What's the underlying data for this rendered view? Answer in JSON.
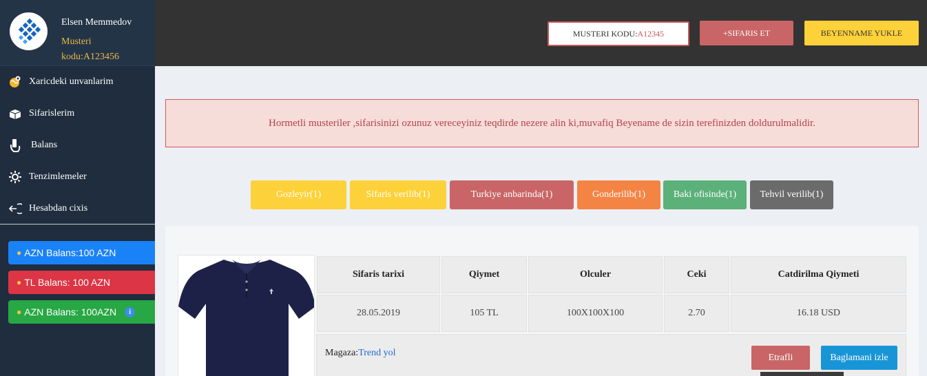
{
  "profile": {
    "name": "Elsen Memmedov",
    "role": "Musteri kodu:A123456"
  },
  "menu": [
    {
      "label": "Xaricdeki unvanlarim",
      "icon": "globe-pin-icon"
    },
    {
      "label": "Sifarislerim",
      "icon": "box-icon"
    },
    {
      "label": "Balans",
      "icon": "hand-money-icon"
    },
    {
      "label": "Tenzimlemeler",
      "icon": "settings-icon"
    },
    {
      "label": "Hesabdan cixis",
      "icon": "logout-icon"
    }
  ],
  "balances": [
    {
      "label": "AZN Balans:100 AZN",
      "color": "#1a82f7"
    },
    {
      "label": "TL Balans: 100 AZN",
      "color": "#dc3545"
    },
    {
      "label": "AZN Balans: 100AZN",
      "color": "#28a745",
      "info": "i"
    }
  ],
  "topbar": {
    "code_label": "MUSTERI KODU:",
    "code_value": "A12345",
    "order_button": "+SIFARIS ET",
    "declaration_button": "BEYENNAME YUKLE"
  },
  "alert": "Hormetli musteriler ,sifarisinizi ozunuz vereceyiniz teqdirde nezere alin ki,muvafiq Beyename de sizin terefinizden doldurulmalidir.",
  "statuses": [
    {
      "label": "Gozleyir(1)",
      "color": "#fcd139"
    },
    {
      "label": "Sifaris verilib(1)",
      "color": "#fcd139"
    },
    {
      "label": "Turkiye anbarinda(1)",
      "color": "#c96566"
    },
    {
      "label": "Gonderilib(1)",
      "color": "#f48444"
    },
    {
      "label": "Baki ofisinde(1)",
      "color": "#5cb07a"
    },
    {
      "label": "Tehvil verilib(1)",
      "color": "#6b6b6b"
    }
  ],
  "order": {
    "headers": [
      "Sifaris tarixi",
      "Qiymet",
      "Olculer",
      "Ceki",
      "Catdirilma Qiymeti"
    ],
    "values": [
      "28.05.2019",
      "105 TL",
      "100X100X100",
      "2.70",
      "16.18 USD"
    ],
    "shop_label": "Magaza:",
    "shop_name": "Trend yol",
    "detail_button": "Etrafli",
    "track_button": "Baglamani izle"
  }
}
